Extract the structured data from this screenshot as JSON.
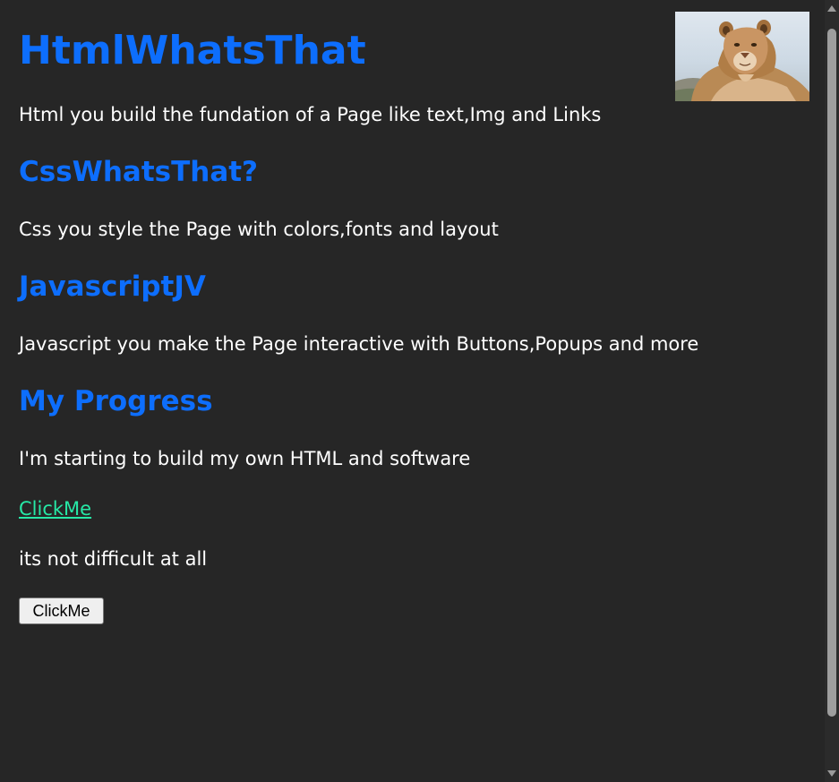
{
  "page": {
    "background": "#262626",
    "heading_color": "#0d6efd",
    "link_color": "#26e8a6",
    "text_color": "#ffffff"
  },
  "hero_image": {
    "subject": "lioness photo",
    "icon": "lion-image"
  },
  "sections": {
    "html_title": "HtmlWhatsThat",
    "html_text": "Html you build the fundation of a Page like text,Img and Links",
    "css_title": "CssWhatsThat?",
    "css_text": "Css you style the Page with colors,fonts and layout",
    "js_title": "JavascriptJV",
    "js_text": "Javascript you make the Page interactive with Buttons,Popups and more",
    "progress_title": "My Progress",
    "progress_text": "I'm starting to build my own HTML and software",
    "link_label": "ClickMe",
    "closing_text": "its not difficult at all",
    "button_label": "ClickMe"
  }
}
